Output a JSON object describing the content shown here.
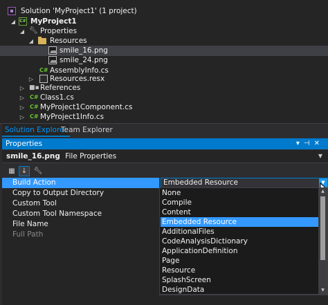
{
  "solution_explorer": {
    "items": [
      {
        "label": "Solution 'MyProject1' (1 project)",
        "icon": "solution-icon"
      },
      {
        "label": "MyProject1",
        "icon": "csharp-project-icon"
      },
      {
        "label": "Properties",
        "icon": "wrench-icon"
      },
      {
        "label": "Resources",
        "icon": "folder-icon"
      },
      {
        "label": "smile_16.png",
        "icon": "image-file-icon"
      },
      {
        "label": "smile_24.png",
        "icon": "image-file-icon"
      },
      {
        "label": "AssemblyInfo.cs",
        "icon": "csharp-file-icon"
      },
      {
        "label": "Resources.resx",
        "icon": "resx-file-icon"
      },
      {
        "label": "References",
        "icon": "references-icon"
      },
      {
        "label": "Class1.cs",
        "icon": "csharp-file-icon"
      },
      {
        "label": "MyProject1Component.cs",
        "icon": "csharp-file-icon"
      },
      {
        "label": "MyProject1Info.cs",
        "icon": "csharp-file-icon"
      }
    ]
  },
  "tabs": [
    {
      "label": "Solution Explorer"
    },
    {
      "label": "Team Explorer"
    }
  ],
  "properties": {
    "title": "Properties",
    "object_name": "smile_16.png",
    "object_type": "File Properties",
    "rows": [
      {
        "name": "Build Action",
        "value": "Embedded Resource"
      },
      {
        "name": "Copy to Output Directory",
        "value": ""
      },
      {
        "name": "Custom Tool",
        "value": ""
      },
      {
        "name": "Custom Tool Namespace",
        "value": ""
      },
      {
        "name": "File Name",
        "value": ""
      },
      {
        "name": "Full Path",
        "value": ""
      }
    ],
    "build_action_options": [
      "None",
      "Compile",
      "Content",
      "Embedded Resource",
      "AdditionalFiles",
      "CodeAnalysisDictionary",
      "ApplicationDefinition",
      "Page",
      "Resource",
      "SplashScreen",
      "DesignData"
    ],
    "selected_option": "Embedded Resource"
  },
  "colors": {
    "accent": "#007acc",
    "selection": "#3399ff",
    "background": "#252526"
  }
}
